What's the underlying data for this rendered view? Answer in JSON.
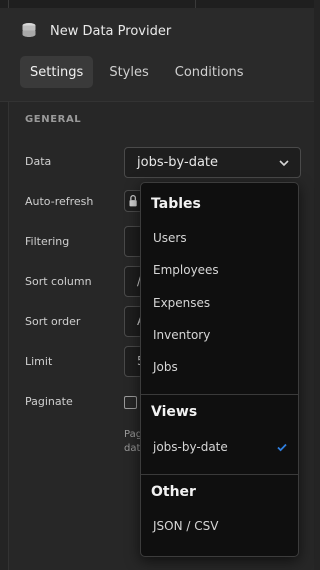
{
  "header": {
    "title": "New Data Provider",
    "tabs": [
      {
        "label": "Settings",
        "active": true
      },
      {
        "label": "Styles",
        "active": false
      },
      {
        "label": "Conditions",
        "active": false
      }
    ]
  },
  "general": {
    "section_title": "GENERAL",
    "labels": {
      "data": "Data",
      "auto_refresh": "Auto-refresh",
      "filtering": "Filtering",
      "sort_column": "Sort column",
      "sort_order": "Sort order",
      "limit": "Limit",
      "paginate": "Paginate"
    },
    "data_value": "jobs-by-date",
    "sort_column_partial": "/",
    "sort_order_partial": "A",
    "limit_partial": "5",
    "helper_partial": "Pag dat"
  },
  "dropdown": {
    "groups": [
      {
        "title": "Tables",
        "items": [
          "Users",
          "Employees",
          "Expenses",
          "Inventory",
          "Jobs"
        ]
      },
      {
        "title": "Views",
        "items": [
          "jobs-by-date"
        ]
      },
      {
        "title": "Other",
        "items": [
          "JSON / CSV"
        ]
      }
    ],
    "selected": "jobs-by-date"
  },
  "colors": {
    "accent_check": "#2f7fe0",
    "background": "#242424",
    "dropdown_bg": "#0f0f0f"
  }
}
